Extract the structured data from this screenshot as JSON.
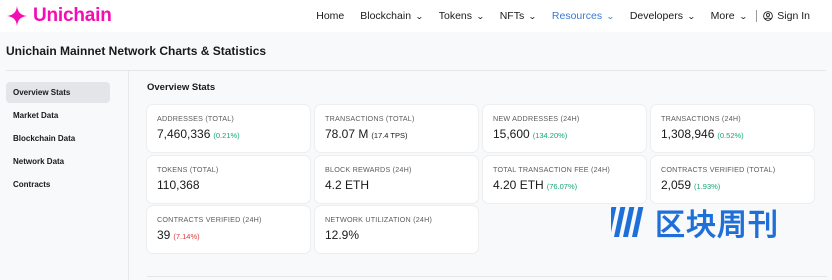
{
  "brand": {
    "name": "Unichain",
    "color": "#f50db4",
    "icon": "unichain-sparkle-icon"
  },
  "nav": {
    "items": [
      {
        "label": "Home",
        "dropdown": false,
        "active": false
      },
      {
        "label": "Blockchain",
        "dropdown": true,
        "active": false
      },
      {
        "label": "Tokens",
        "dropdown": true,
        "active": false
      },
      {
        "label": "NFTs",
        "dropdown": true,
        "active": false
      },
      {
        "label": "Resources",
        "dropdown": true,
        "active": true
      },
      {
        "label": "Developers",
        "dropdown": true,
        "active": false
      },
      {
        "label": "More",
        "dropdown": true,
        "active": false
      }
    ],
    "signin": "Sign In",
    "chevron": "⌄",
    "active_color": "#3a7bd5"
  },
  "page": {
    "title": "Unichain Mainnet Network Charts & Statistics"
  },
  "sidebar": {
    "items": [
      {
        "label": "Overview Stats",
        "active": true
      },
      {
        "label": "Market Data",
        "active": false
      },
      {
        "label": "Blockchain Data",
        "active": false
      },
      {
        "label": "Network Data",
        "active": false
      },
      {
        "label": "Contracts",
        "active": false
      }
    ]
  },
  "main": {
    "title": "Overview Stats",
    "cards": [
      {
        "label": "ADDRESSES (TOTAL)",
        "value": "7,460,336",
        "sub": "(0.21%)",
        "sub_tone": "green"
      },
      {
        "label": "TRANSACTIONS (TOTAL)",
        "value": "78.07 M",
        "sub": "(17.4 TPS)",
        "sub_tone": "dark"
      },
      {
        "label": "NEW ADDRESSES (24H)",
        "value": "15,600",
        "sub": "(134.20%)",
        "sub_tone": "green"
      },
      {
        "label": "TRANSACTIONS (24H)",
        "value": "1,308,946",
        "sub": "(0.52%)",
        "sub_tone": "green"
      },
      {
        "label": "TOKENS (TOTAL)",
        "value": "110,368",
        "sub": "",
        "sub_tone": "dark"
      },
      {
        "label": "BLOCK REWARDS (24H)",
        "value": "4.2 ETH",
        "sub": "",
        "sub_tone": "dark"
      },
      {
        "label": "TOTAL TRANSACTION FEE (24H)",
        "value": "4.20 ETH",
        "sub": "(76.07%)",
        "sub_tone": "green"
      },
      {
        "label": "CONTRACTS VERIFIED (TOTAL)",
        "value": "2,059",
        "sub": "(1.93%)",
        "sub_tone": "green"
      },
      {
        "label": "CONTRACTS VERIFIED (24H)",
        "value": "39",
        "sub": "(7.14%)",
        "sub_tone": "red"
      },
      {
        "label": "NETWORK UTILIZATION (24H)",
        "value": "12.9%",
        "sub": "",
        "sub_tone": "dark"
      }
    ]
  },
  "watermark": {
    "text": "区块周刊",
    "color": "#1f6fd9"
  },
  "colors": {
    "green": "#17a673",
    "red": "#e03a3a",
    "page_bg": "#f8f9fa"
  }
}
